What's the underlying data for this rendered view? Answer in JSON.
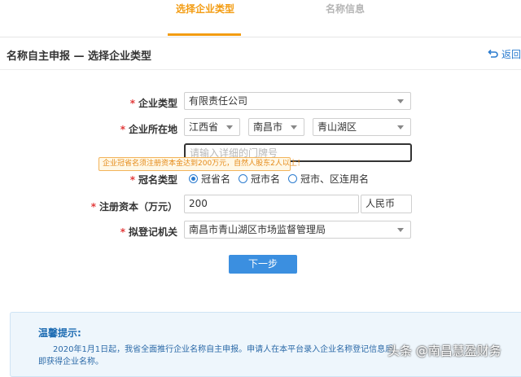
{
  "steps": {
    "active": "选择企业类型",
    "inactive": "名称信息"
  },
  "header": {
    "title": "名称自主申报 — 选择企业类型",
    "back": "返回"
  },
  "form": {
    "company_type": {
      "label": "企业类型",
      "value": "有限责任公司"
    },
    "location": {
      "label": "企业所在地",
      "province": "江西省",
      "city": "南昌市",
      "district": "青山湖区",
      "address_placeholder": "请输入详细的门牌号"
    },
    "tooltip": "企业冠省名须注册资本金达到200万元，自然人股东2人以上！",
    "crown": {
      "label": "冠名类型",
      "options": [
        "冠省名",
        "冠市名",
        "冠市、区连用名"
      ],
      "selected": "冠省名"
    },
    "capital": {
      "label": "注册资本（万元）",
      "value": "200",
      "currency": "人民币"
    },
    "authority": {
      "label": "拟登记机关",
      "value": "南昌市青山湖区市场监督管理局"
    },
    "required_mark": "*",
    "next_button": "下一步"
  },
  "tips": {
    "title": "温馨提示:",
    "line1": "2020年1月1日起，我省全面推行企业名称自主申报。申请人在本平台录入企业名称登记信息后",
    "line2": "即获得企业名称。"
  },
  "watermark": "头条 @南昌慧盈财务"
}
